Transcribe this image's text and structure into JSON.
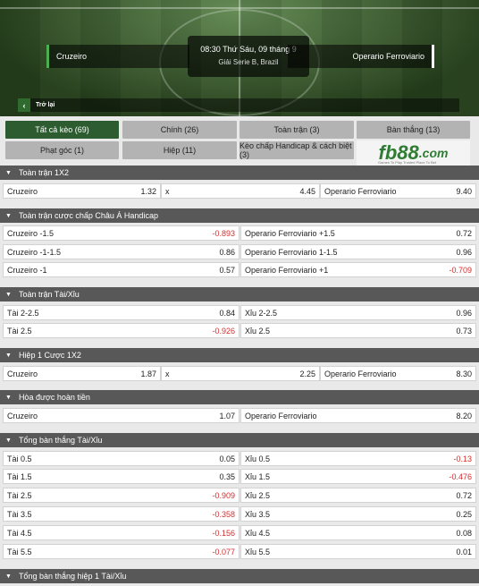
{
  "match": {
    "home": "Cruzeiro",
    "away": "Operario Ferroviario",
    "time": "08:30 Thứ Sáu, 09 tháng 9",
    "league": "Giải Serie B, Brazil",
    "back_label": "Trở lại"
  },
  "tabs": [
    "Tất cả kèo (69)",
    "Chính (26)",
    "Toàn trận (3)",
    "Bàn thắng (13)",
    "Phạt góc (1)",
    "Hiệp (11)",
    "Kèo chấp Handicap & cách biệt (3)"
  ],
  "promo": {
    "brand_fb": "fb88",
    "brand_com": ".com",
    "tagline": "Games To Play  Trusted Place To Bet"
  },
  "sections": {
    "s1": {
      "title": "Toàn trận 1X2",
      "cells": [
        {
          "label": "Cruzeiro",
          "odd": "1.32"
        },
        {
          "label": "x",
          "odd": "4.45"
        },
        {
          "label": "Operario Ferroviario",
          "odd": "9.40"
        }
      ]
    },
    "s2": {
      "title": "Toàn trận cược chấp Châu Á Handicap",
      "rows": [
        [
          {
            "label": "Cruzeiro -1.5",
            "odd": "-0.893"
          },
          {
            "label": "Operario Ferroviario +1.5",
            "odd": "0.72"
          }
        ],
        [
          {
            "label": "Cruzeiro -1-1.5",
            "odd": "0.86"
          },
          {
            "label": "Operario Ferroviario 1-1.5",
            "odd": "0.96"
          }
        ],
        [
          {
            "label": "Cruzeiro -1",
            "odd": "0.57"
          },
          {
            "label": "Operario Ferroviario +1",
            "odd": "-0.709"
          }
        ]
      ]
    },
    "s3": {
      "title": "Toàn trận Tài/Xỉu",
      "rows": [
        [
          {
            "label": "Tài 2-2.5",
            "odd": "0.84"
          },
          {
            "label": "Xỉu 2-2.5",
            "odd": "0.96"
          }
        ],
        [
          {
            "label": "Tài 2.5",
            "odd": "-0.926"
          },
          {
            "label": "Xỉu 2.5",
            "odd": "0.73"
          }
        ]
      ]
    },
    "s4": {
      "title": "Hiệp 1 Cược 1X2",
      "cells": [
        {
          "label": "Cruzeiro",
          "odd": "1.87"
        },
        {
          "label": "x",
          "odd": "2.25"
        },
        {
          "label": "Operario Ferroviario",
          "odd": "8.30"
        }
      ]
    },
    "s5": {
      "title": "Hòa được hoàn tiền",
      "row": [
        {
          "label": "Cruzeiro",
          "odd": "1.07"
        },
        {
          "label": "Operario Ferroviario",
          "odd": "8.20"
        }
      ]
    },
    "s6": {
      "title": "Tổng bàn thắng Tài/Xỉu",
      "rows": [
        [
          {
            "label": "Tài 0.5",
            "odd": "0.05"
          },
          {
            "label": "Xỉu 0.5",
            "odd": "-0.13"
          }
        ],
        [
          {
            "label": "Tài 1.5",
            "odd": "0.35"
          },
          {
            "label": "Xỉu 1.5",
            "odd": "-0.476"
          }
        ],
        [
          {
            "label": "Tài 2.5",
            "odd": "-0.909"
          },
          {
            "label": "Xỉu 2.5",
            "odd": "0.72"
          }
        ],
        [
          {
            "label": "Tài 3.5",
            "odd": "-0.358"
          },
          {
            "label": "Xỉu 3.5",
            "odd": "0.25"
          }
        ],
        [
          {
            "label": "Tài 4.5",
            "odd": "-0.156"
          },
          {
            "label": "Xỉu 4.5",
            "odd": "0.08"
          }
        ],
        [
          {
            "label": "Tài 5.5",
            "odd": "-0.077"
          },
          {
            "label": "Xỉu 5.5",
            "odd": "0.01"
          }
        ]
      ]
    },
    "s7": {
      "title": "Tổng bàn thắng hiệp 1 Tài/Xỉu"
    }
  },
  "colors": {
    "active_tab": "#2c5c2f",
    "section_header": "#585858",
    "negative_odd": "#d32f2f"
  }
}
